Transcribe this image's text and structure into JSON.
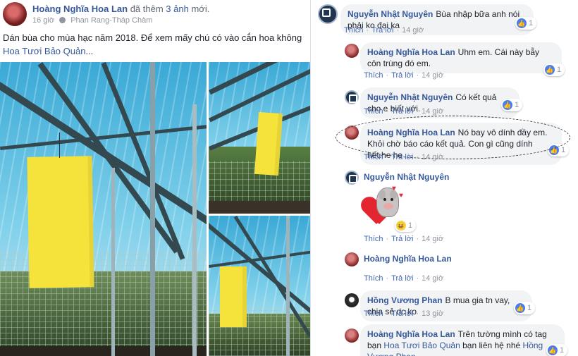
{
  "post": {
    "author": "Hoàng Nghĩa Hoa Lan",
    "action_prefix": "đã thêm",
    "photo_count": "3 ảnh",
    "action_suffix": "mới.",
    "time": "16 giờ",
    "location": "Phan Rang-Tháp Chàm",
    "text": "Dán bùa cho mùa hạc năm 2018. Để xem mấy chú có vào cắn hoa không",
    "text_link": "Hoa Tươi Bảo Quản",
    "text_end": "..."
  },
  "comments": [
    {
      "author": "Nguyễn Nhật Nguyên",
      "text": "Bùa nhập bữa anh nói phải ko đại ka",
      "actions": [
        "Thích",
        "Trả lời"
      ],
      "time": "14 giờ",
      "likes": "1"
    },
    {
      "author": "Hoàng Nghĩa Hoa Lan",
      "text": "Uhm em. Cái này bẫy côn trùng đó em.",
      "actions": [
        "Thích",
        "Trả lời"
      ],
      "time": "14 giờ",
      "likes": "1"
    },
    {
      "author": "Nguyễn Nhật Nguyên",
      "text": "Có kết quả cho e biết với.",
      "actions": [
        "Thích",
        "Trả lời"
      ],
      "time": "14 giờ",
      "likes": "1"
    },
    {
      "author": "Hoàng Nghĩa Hoa Lan",
      "text": "Nó bay vô dính đầy em. Khỏi chờ báo cáo kết quả. Con gì cũng dính hết.he he",
      "actions": [
        "Thích",
        "Trả lời"
      ],
      "time": "14 giờ",
      "likes": "1"
    },
    {
      "author": "Nguyễn Nhật Nguyên",
      "text": "",
      "actions": [
        "Thích",
        "Trả lời"
      ],
      "time": "14 giờ",
      "likes": "1"
    },
    {
      "author": "Hoàng Nghĩa Hoa Lan",
      "text": "",
      "actions": [
        "Thích",
        "Trả lời"
      ],
      "time": "14 giờ"
    },
    {
      "author": "Hồng Vương Phan",
      "text": "B mua gia tn vay, chia sẻ dc ko",
      "actions": [
        "Thích",
        "Trả lời"
      ],
      "time": "13 giờ",
      "likes": "1"
    },
    {
      "author": "Hoàng Nghĩa Hoa Lan",
      "text_before": "Trên tường mình có tag bạn",
      "tag1": "Hoa Tươi Bảo Quản",
      "text_mid": "bạn liên hệ nhé",
      "tag2": "Hồng Vương Phan",
      "text_end": ".",
      "likes": "1"
    }
  ],
  "colors": {
    "link": "#365899",
    "like": "#4a7df0",
    "trap": "#f5e23b"
  },
  "icons": [
    "globe-icon",
    "like-icon",
    "haha-icon",
    "sticker-pig-heart"
  ]
}
